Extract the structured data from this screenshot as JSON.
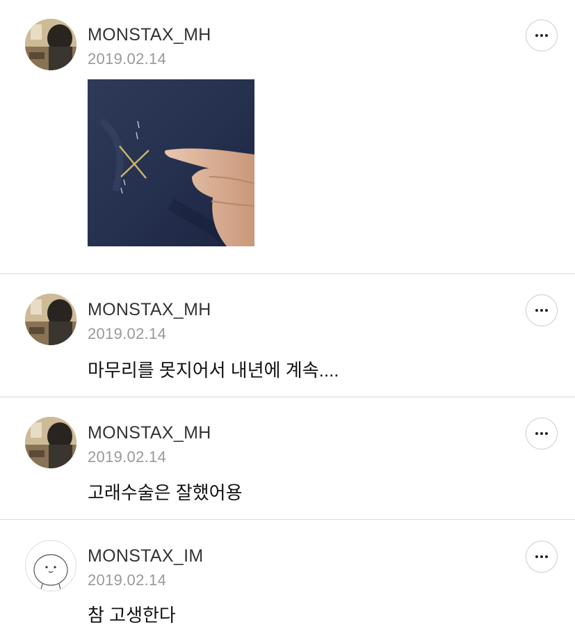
{
  "posts": [
    {
      "username": "MONSTAX_MH",
      "date": "2019.02.14",
      "text": "",
      "avatar": "photo-avatar",
      "has_image": true
    },
    {
      "username": "MONSTAX_MH",
      "date": "2019.02.14",
      "text": "마무리를 못지어서 내년에 계속....",
      "avatar": "photo-avatar"
    },
    {
      "username": "MONSTAX_MH",
      "date": "2019.02.14",
      "text": "고래수술은 잘했어용",
      "avatar": "photo-avatar"
    },
    {
      "username": "MONSTAX_IM",
      "date": "2019.02.14",
      "text": "참 고생한다",
      "avatar": "cartoon-avatar"
    }
  ],
  "icons": {
    "more": "more-options-icon"
  },
  "colors": {
    "username": "#333333",
    "date": "#999999",
    "divider": "#d9d9d9"
  }
}
